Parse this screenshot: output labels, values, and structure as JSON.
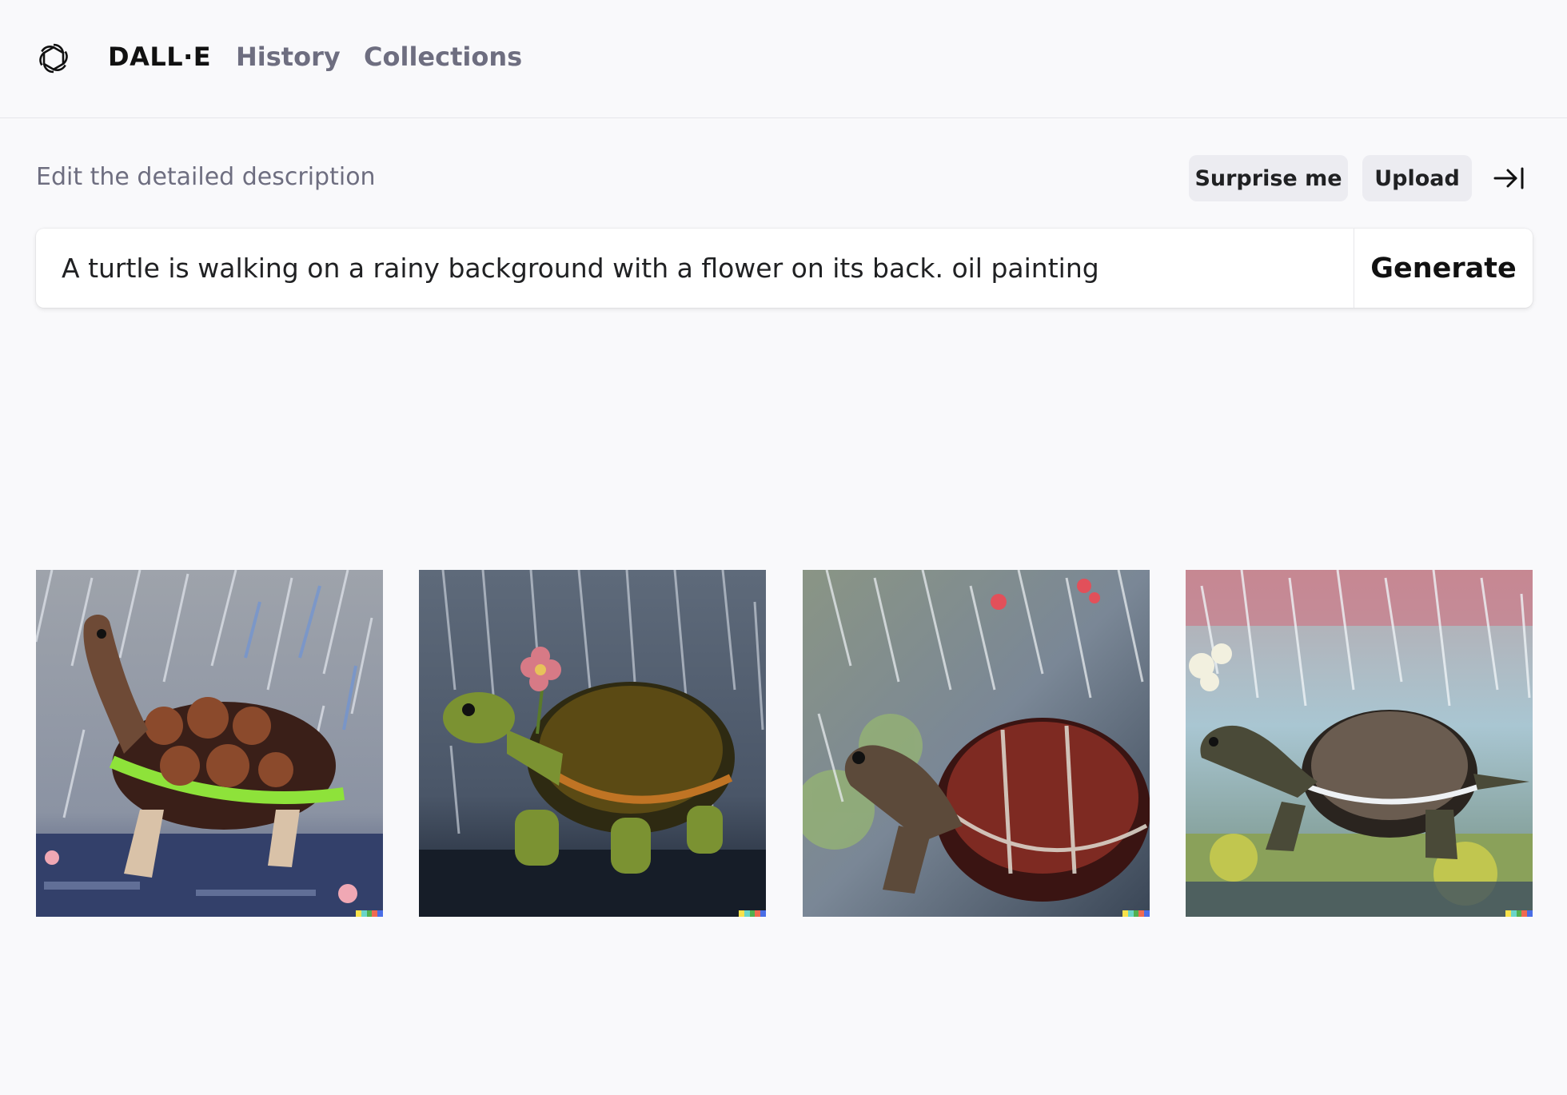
{
  "nav": {
    "brand": "DALL·E",
    "links": [
      {
        "label": "History"
      },
      {
        "label": "Collections"
      }
    ]
  },
  "editor": {
    "heading": "Edit the detailed description",
    "surprise_label": "Surprise me",
    "upload_label": "Upload",
    "prompt": "A turtle is walking on a rainy background with a flower on its back. oil painting",
    "generate_label": "Generate"
  },
  "images": [
    {
      "icon": "turtle-painting-1"
    },
    {
      "icon": "turtle-painting-2"
    },
    {
      "icon": "turtle-painting-3"
    },
    {
      "icon": "turtle-painting-4"
    }
  ],
  "colors": {
    "background": "#f9f9fb",
    "pill": "#ececf1",
    "muted_text": "#6e6e80",
    "signature": [
      "#f9e24a",
      "#6ad5c8",
      "#52b04f",
      "#f06a50",
      "#4a6ee6"
    ]
  }
}
